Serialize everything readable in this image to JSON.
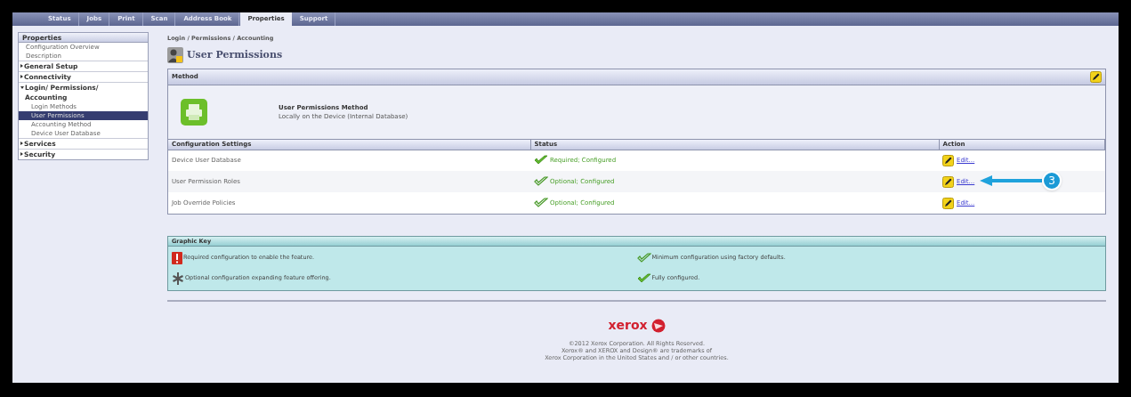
{
  "tabs": [
    {
      "label": "Status",
      "selected": false
    },
    {
      "label": "Jobs",
      "selected": false
    },
    {
      "label": "Print",
      "selected": false
    },
    {
      "label": "Scan",
      "selected": false
    },
    {
      "label": "Address Book",
      "selected": false
    },
    {
      "label": "Properties",
      "selected": true
    },
    {
      "label": "Support",
      "selected": false
    }
  ],
  "sidebar": {
    "title": "Properties",
    "items": [
      {
        "label": "Configuration Overview",
        "kind": "link",
        "selected": false
      },
      {
        "label": "Description",
        "kind": "link",
        "selected": false
      },
      {
        "label": "General Setup",
        "kind": "section",
        "expanded": false
      },
      {
        "label": "Connectivity",
        "kind": "section",
        "expanded": false
      },
      {
        "label": "Login/ Permissions/ Accounting",
        "kind": "section",
        "expanded": true,
        "children": [
          {
            "label": "Login Methods",
            "selected": false
          },
          {
            "label": "User Permissions",
            "selected": true
          },
          {
            "label": "Accounting Method",
            "selected": false
          },
          {
            "label": "Device User Database",
            "selected": false
          }
        ]
      },
      {
        "label": "Services",
        "kind": "section",
        "expanded": false
      },
      {
        "label": "Security",
        "kind": "section",
        "expanded": false
      }
    ]
  },
  "breadcrumb": "Login / Permissions / Accounting",
  "page_title": "User Permissions",
  "method": {
    "header": "Method",
    "title": "User Permissions Method",
    "value": "Locally on the Device (Internal Database)"
  },
  "table": {
    "columns": [
      "Configuration Settings",
      "Status",
      "Action"
    ],
    "rows": [
      {
        "setting": "Device User Database",
        "status": "Required; Configured",
        "kind": "required",
        "action": "Edit..."
      },
      {
        "setting": "User Permission Roles",
        "status": "Optional; Configured",
        "kind": "optional",
        "action": "Edit...",
        "callout": "3"
      },
      {
        "setting": "Job Override Policies",
        "status": "Optional; Configured",
        "kind": "optional",
        "action": "Edit..."
      }
    ]
  },
  "graphic_key": {
    "title": "Graphic Key",
    "items": [
      {
        "kind": "required",
        "label": "Required configuration to enable the feature."
      },
      {
        "kind": "minimum",
        "label": "Minimum configuration using factory defaults."
      },
      {
        "kind": "optional",
        "label": "Optional configuration expanding feature offering."
      },
      {
        "kind": "configured",
        "label": "Fully configured."
      }
    ]
  },
  "footer": {
    "logo": "xerox",
    "lines": [
      "©2012 Xerox Corporation. All Rights Reserved.",
      "Xerox® and XEROX and Design® are trademarks of",
      "Xerox Corporation in the United States and / or other countries."
    ]
  }
}
